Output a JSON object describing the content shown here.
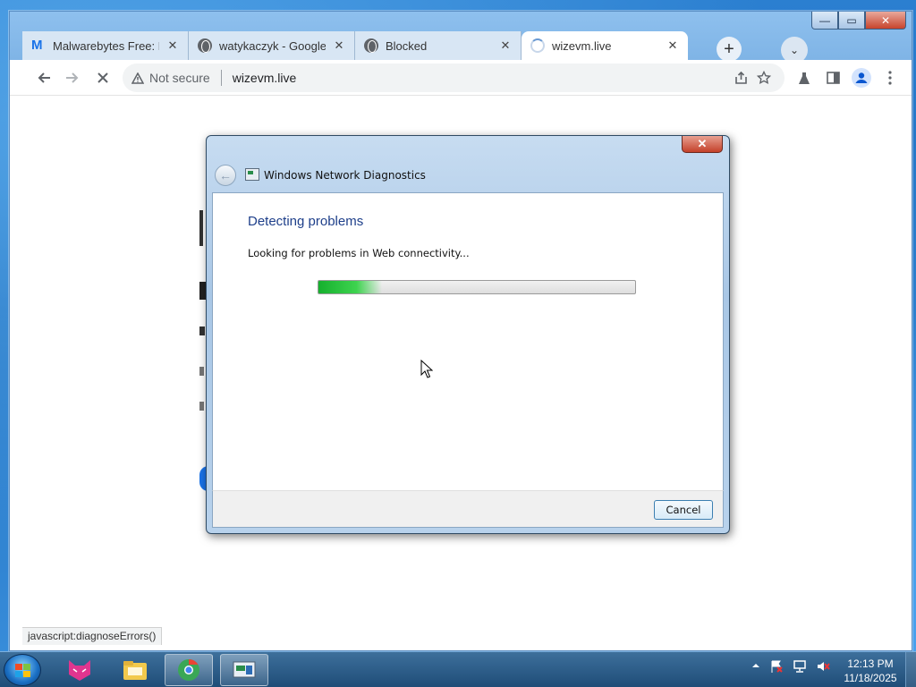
{
  "browser": {
    "tabs": [
      {
        "label": "Malwarebytes Free: Fr",
        "icon": "malwarebytes-icon",
        "active": false
      },
      {
        "label": "watykaczyk - Google S",
        "icon": "globe-icon",
        "active": false
      },
      {
        "label": "Blocked",
        "icon": "globe-icon",
        "active": false
      },
      {
        "label": "wizevm.live",
        "icon": "loading-spinner-icon",
        "active": true
      }
    ],
    "close_glyph": "✕",
    "new_tab_glyph": "+",
    "tab_search_glyph": "⌄",
    "security_label": "Not secure",
    "url": "wizevm.live",
    "status_text": "javascript:diagnoseErrors()"
  },
  "window_controls": {
    "minimize": "—",
    "maximize": "▭",
    "close": "✕"
  },
  "dialog": {
    "app_title": "Windows Network Diagnostics",
    "heading": "Detecting problems",
    "message": "Looking for problems in Web connectivity...",
    "progress_fraction": 0.2,
    "close_glyph": "✕",
    "back_glyph": "←",
    "cancel_label": "Cancel"
  },
  "taskbar": {
    "apps": [
      "start-orb",
      "cat-app-icon",
      "file-explorer-icon",
      "chrome-icon",
      "network-diagnostics-icon"
    ],
    "clock_time": "12:13 PM",
    "clock_date": "11/18/2025"
  },
  "colors": {
    "dialog_heading": "#1e3f8a",
    "progress_green": "#16b02e",
    "taskbar": "#1f4d78"
  }
}
